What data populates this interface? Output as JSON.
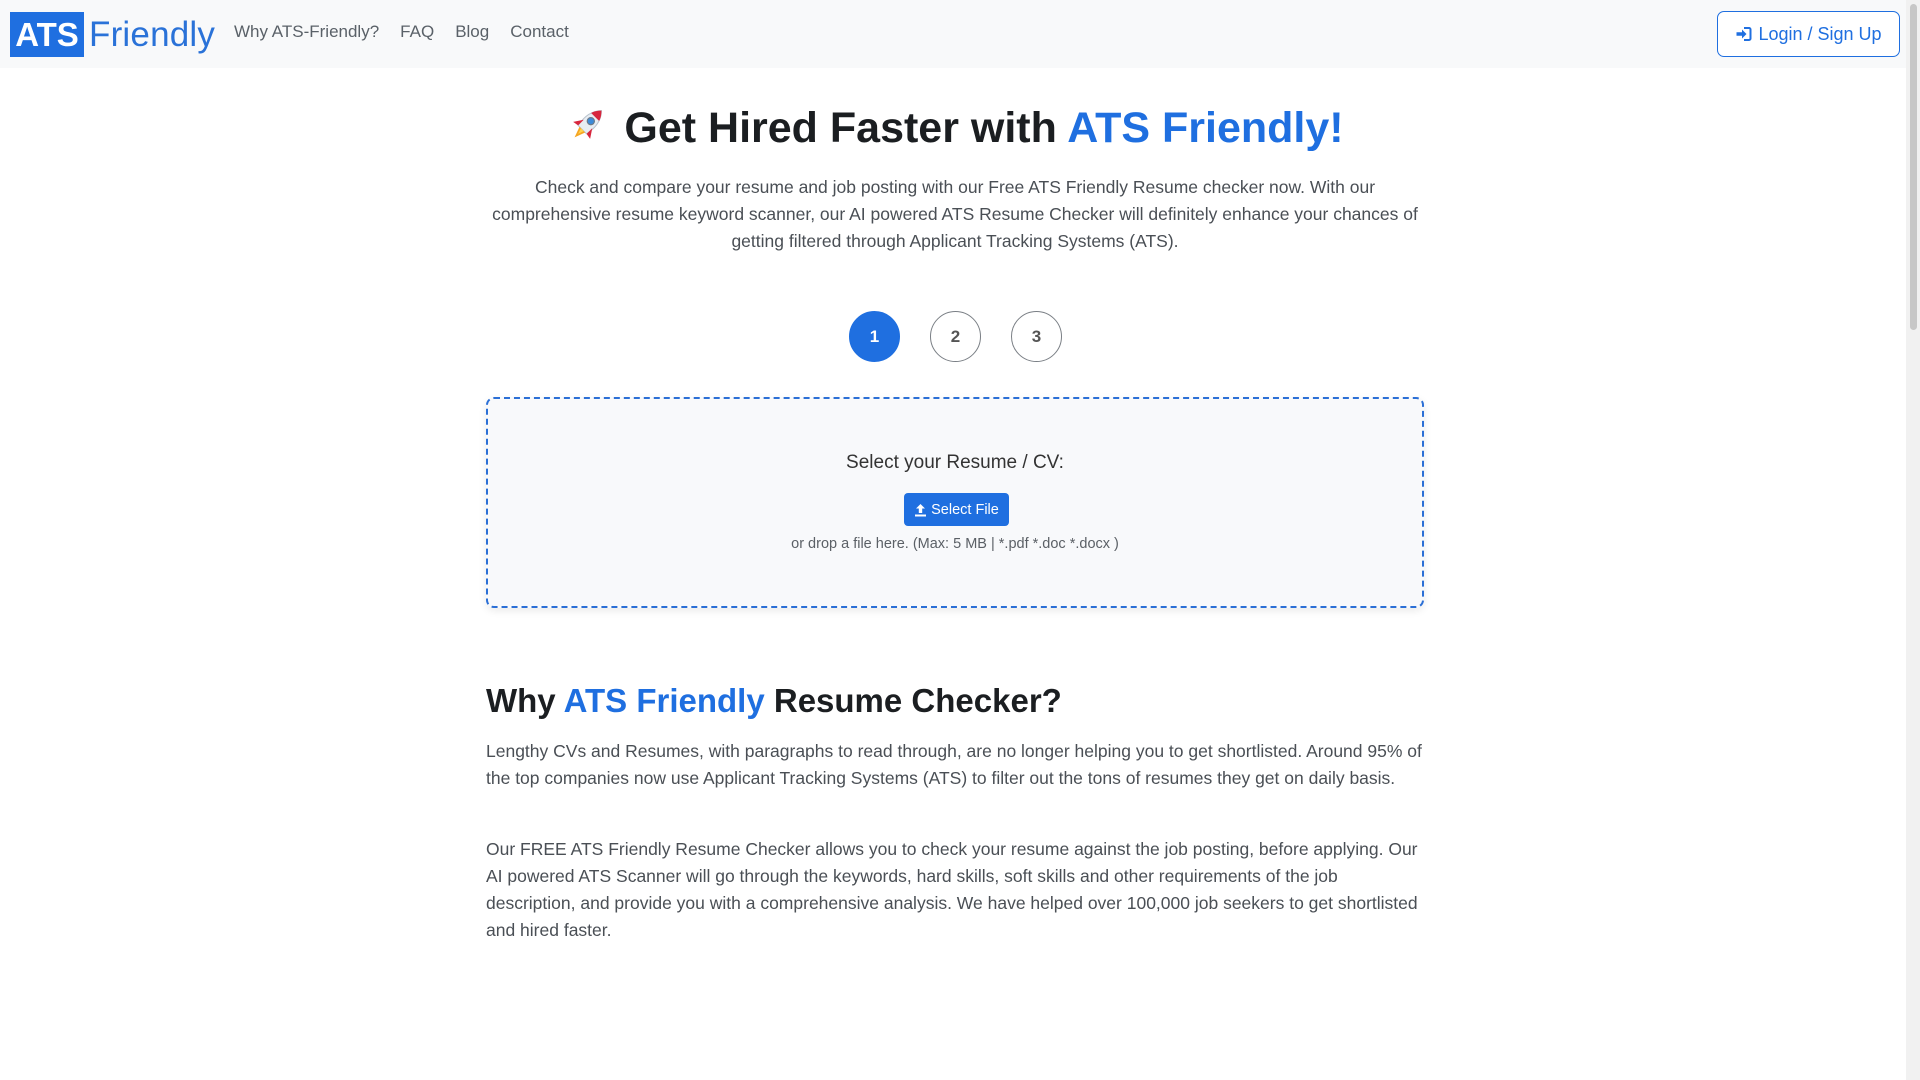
{
  "nav": {
    "brand_ats": "ATS",
    "brand_friendly": "Friendly",
    "links": [
      "Why ATS-Friendly?",
      "FAQ",
      "Blog",
      "Contact"
    ],
    "login_label": "Login / Sign Up"
  },
  "hero": {
    "title_prefix": "Get Hired Faster with ",
    "title_accent": "ATS Friendly!",
    "subtitle": "Check and compare your resume and job posting with our Free ATS Friendly Resume checker now. With our comprehensive resume keyword scanner, our AI powered ATS Resume Checker will definitely enhance your chances of getting filtered through Applicant Tracking Systems (ATS)."
  },
  "steps": {
    "items": [
      "1",
      "2",
      "3"
    ],
    "active_index": 0
  },
  "upload": {
    "label": "Select your Resume / CV:",
    "button_label": "Select File",
    "hint": "or drop a file here. (Max: 5 MB | *.pdf *.doc *.docx )"
  },
  "why": {
    "title_prefix": "Why ",
    "title_accent": "ATS Friendly",
    "title_suffix": " Resume Checker?",
    "paragraph1": "Lengthy CVs and Resumes, with paragraphs to read through, are no longer helping you to get shortlisted. Around 95% of the top companies now use Applicant Tracking Systems (ATS) to filter out the tons of resumes they get on daily basis.",
    "paragraph2": "Our FREE ATS Friendly Resume Checker allows you to check your resume against the job posting, before applying. Our AI powered ATS Scanner will go through the keywords, hard skills, soft skills and other requirements of the job description, and provide you with a comprehensive analysis. We have helped over 100,000 job seekers to get shortlisted and hired faster."
  },
  "colors": {
    "accent": "#1f6fe0",
    "navbar_bg": "#f8f9fa",
    "text_muted": "#4a4f55"
  },
  "icons": {
    "hero": "rocket-icon",
    "login": "sign-in-icon",
    "upload": "upload-icon"
  }
}
